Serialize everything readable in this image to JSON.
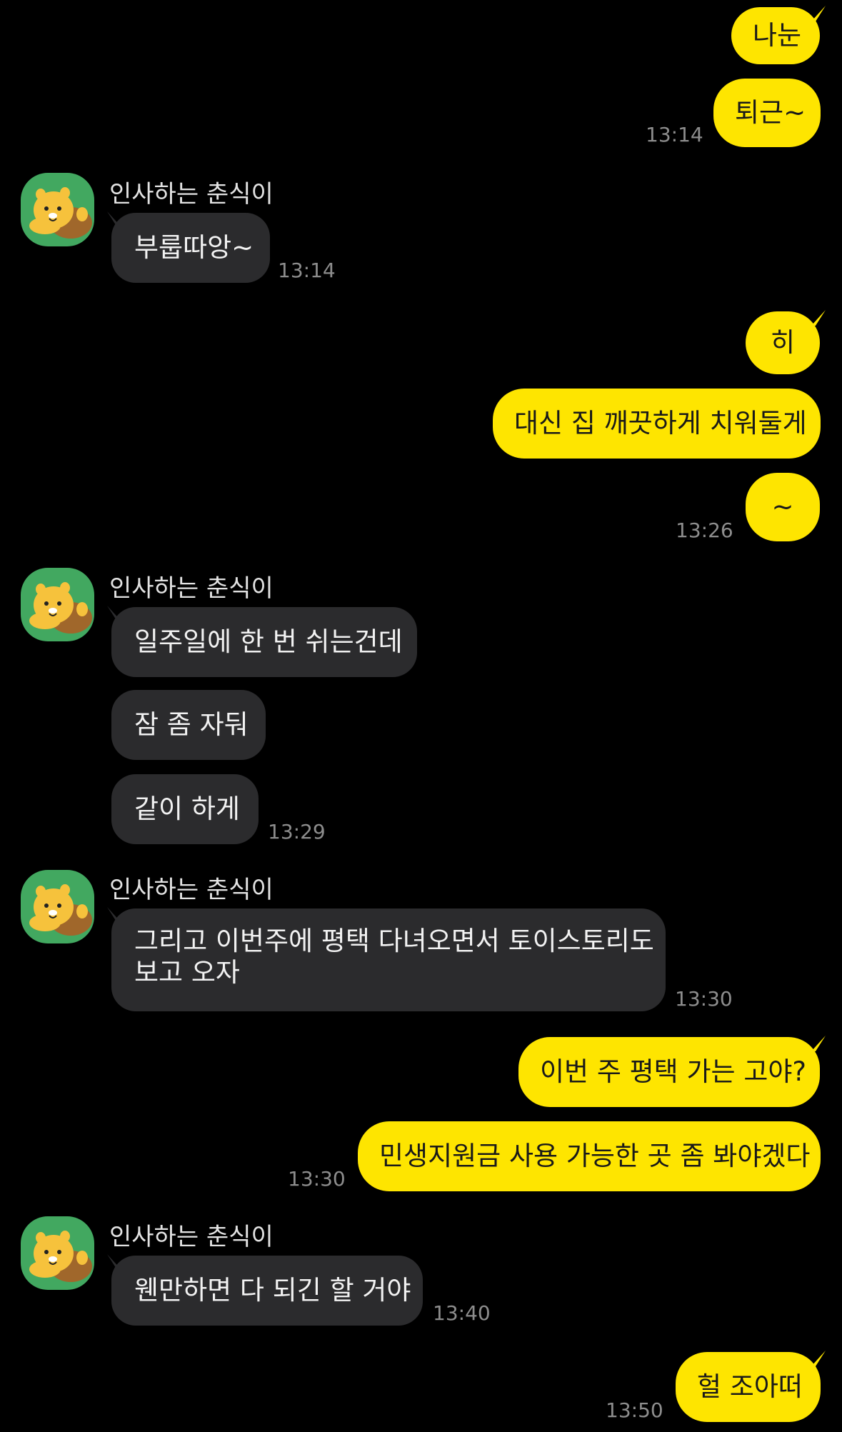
{
  "contact": {
    "name": "인사하는 춘식이",
    "avatar_icon": "chunsik-avatar-icon",
    "avatar_bg": "#42a860"
  },
  "colors": {
    "background": "#000000",
    "my_bubble": "#fee500",
    "their_bubble": "#2b2b2d",
    "time_text": "#8d8d8d"
  },
  "messages": [
    {
      "from": "me",
      "text": "나눈"
    },
    {
      "from": "me",
      "text": "퇴근~",
      "time": "13:14"
    },
    {
      "from": "them",
      "sender": "인사하는 춘식이",
      "text": "부룹따앙~",
      "time": "13:14"
    },
    {
      "from": "me",
      "text": "히"
    },
    {
      "from": "me",
      "text": "대신 집 깨끗하게 치워둘게"
    },
    {
      "from": "me",
      "text": "~",
      "time": "13:26"
    },
    {
      "from": "them",
      "sender": "인사하는 춘식이",
      "text": "일주일에 한 번 쉬는건데"
    },
    {
      "from": "them",
      "text": "잠 좀 자둬"
    },
    {
      "from": "them",
      "text": "같이 하게",
      "time": "13:29"
    },
    {
      "from": "them",
      "sender": "인사하는 춘식이",
      "text_line1": "그리고 이번주에 평택 다녀오면서 토이스토리도",
      "text_line2": "보고 오자",
      "time": "13:30"
    },
    {
      "from": "me",
      "text": "이번 주 평택 가는 고야?"
    },
    {
      "from": "me",
      "text": "민생지원금 사용 가능한 곳 좀 봐야겠다",
      "time": "13:30"
    },
    {
      "from": "them",
      "sender": "인사하는 춘식이",
      "text": "웬만하면 다 되긴 할 거야",
      "time": "13:40"
    },
    {
      "from": "me",
      "text": "헐 조아떠",
      "time": "13:50"
    }
  ]
}
